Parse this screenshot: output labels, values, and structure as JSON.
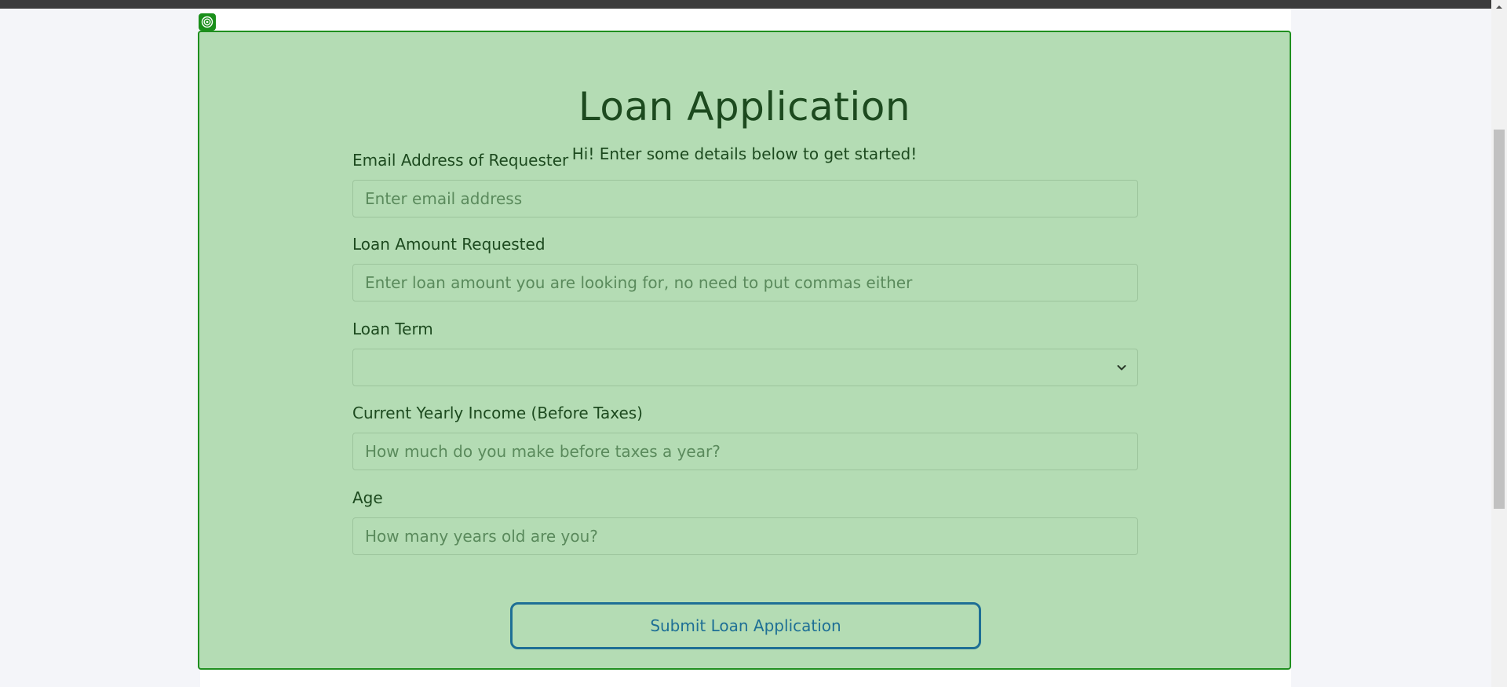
{
  "form": {
    "title": "Loan Application",
    "subtitle": "Hi! Enter some details below to get started!",
    "fields": {
      "email": {
        "label": "Email Address of Requester",
        "placeholder": "Enter email address",
        "value": ""
      },
      "amount": {
        "label": "Loan Amount Requested",
        "placeholder": "Enter loan amount you are looking for, no need to put commas either",
        "value": ""
      },
      "term": {
        "label": "Loan Term",
        "selected": ""
      },
      "income": {
        "label": "Current Yearly Income (Before Taxes)",
        "placeholder": "How much do you make before taxes a year?",
        "value": ""
      },
      "age": {
        "label": "Age",
        "placeholder": "How many years old are you?",
        "value": ""
      }
    },
    "submit_label": "Submit Loan Application"
  },
  "icons": {
    "badge": "target-icon",
    "select": "chevron-down-icon",
    "scroll_up": "scroll-up-arrow-icon"
  },
  "colors": {
    "card_background": "#b4dcb4",
    "card_border": "#1f8f1f",
    "text": "#1d4a1f",
    "button_accent": "#1e6f95",
    "badge": "#1a8f1a"
  }
}
